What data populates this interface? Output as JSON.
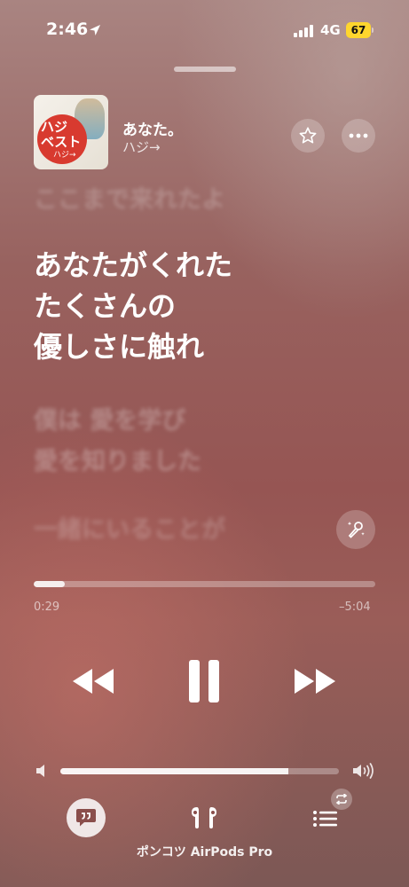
{
  "status_bar": {
    "time": "2:46",
    "network": "4G",
    "battery": "67",
    "icons": [
      "location-arrow-icon",
      "cellular-signal-icon",
      "battery-icon"
    ]
  },
  "now_playing": {
    "title": "あなた。",
    "artist": "ハジ→",
    "artwork": {
      "text": "ハジ ベスト",
      "subtext": "ハジ→"
    }
  },
  "lyrics": {
    "previous": "ここまで来れたよ",
    "current": [
      "あなたがくれた",
      "たくさんの",
      "優しさに触れ"
    ],
    "next": [
      "僕は 愛を学び",
      "愛を知りました"
    ],
    "upcoming": "一緒にいることが"
  },
  "playback": {
    "elapsed": "0:29",
    "remaining": "–5:04",
    "progress": 0.09
  },
  "volume": {
    "level": 0.82
  },
  "output": {
    "device": "ポンコツ AirPods Pro"
  },
  "colors": {
    "battery": "#ffd62e",
    "artwork_accent": "#d83a2f"
  }
}
